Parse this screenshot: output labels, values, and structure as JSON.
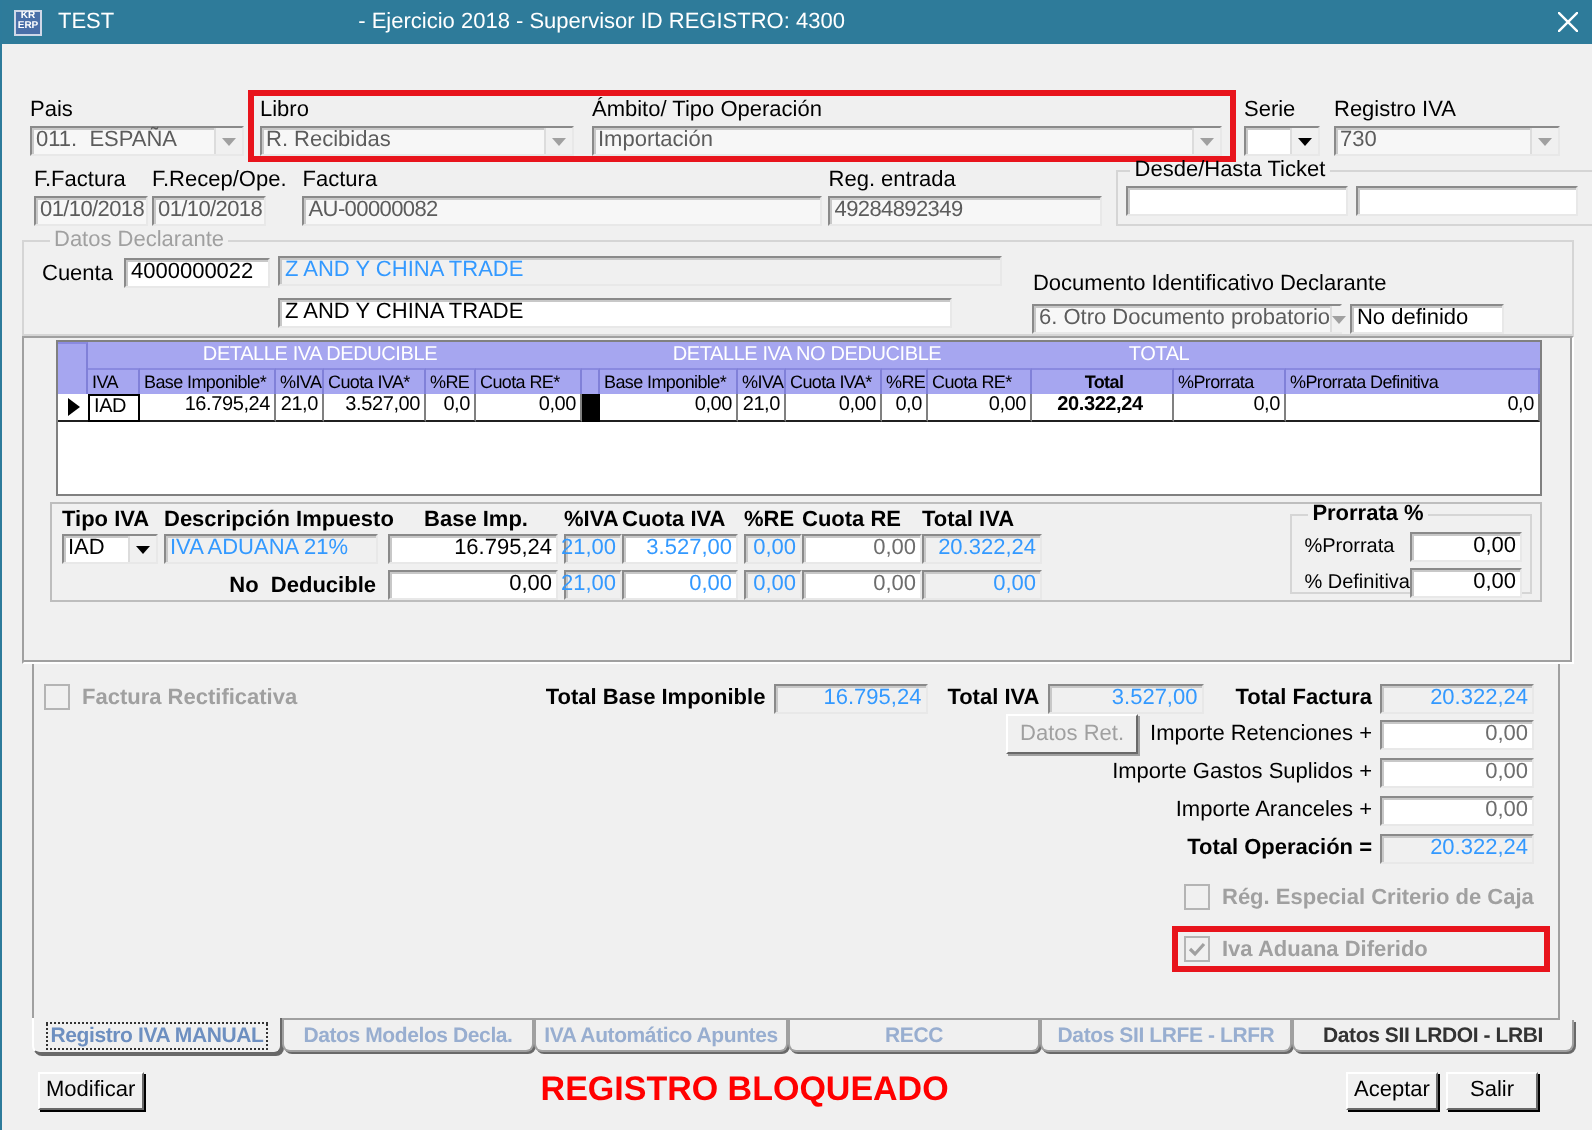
{
  "window": {
    "logo": [
      "KR",
      "ERP"
    ],
    "app": "TEST",
    "title": "- Ejercicio 2018 - Supervisor ID REGISTRO: 4300"
  },
  "header": {
    "row_1": [
      {
        "label": "Pais",
        "value": "011.  ESPAÑA",
        "kind": "disabled",
        "combo": true,
        "highlighted": false
      },
      {
        "label": "Libro",
        "value": "R. Recibidas",
        "kind": "disabled",
        "combo": true,
        "highlighted": true
      },
      {
        "label": "Ámbito/ Tipo Operación",
        "value": "Importación",
        "kind": "disabled",
        "combo": true,
        "highlighted": true
      },
      {
        "label": "Serie",
        "kind": "edit",
        "combo": true,
        "highlighted": false
      },
      {
        "label": "Registro IVA",
        "value": "730",
        "kind": "disabled",
        "combo": true,
        "highlighted": false
      }
    ],
    "row_2": [
      {
        "label": "F.Factura",
        "value": "01/10/2018",
        "kind": "disabled"
      },
      {
        "label": "F.Recep/Ope.",
        "value": "01/10/2018",
        "kind": "disabled"
      },
      {
        "label": "Factura",
        "value": "AU-00000082",
        "kind": "disabled"
      },
      {
        "label": "Reg. entrada",
        "value": "49284892349",
        "kind": "disabled"
      }
    ],
    "ticket": {
      "title": "Desde/Hasta Ticket",
      "fields": [
        {
          "kind": "edit"
        },
        {
          "kind": "edit"
        }
      ]
    }
  },
  "declarante": {
    "title": "Datos Declarante",
    "disabled": true,
    "account_label": "Cuenta",
    "account": {
      "value": "4000000022",
      "kind": "edit"
    },
    "name": {
      "value": "Z AND Y CHINA TRADE",
      "kind": "info"
    },
    "name_2": {
      "value": "Z AND Y CHINA TRADE",
      "kind": "edit"
    },
    "document_label": "Documento Identificativo Declarante",
    "document_type": {
      "value": "6. Otro Documento probatorio",
      "kind": "disabled",
      "combo": true
    },
    "document_number": {
      "value": "No definido",
      "kind": "edit"
    }
  },
  "vat_grid": {
    "groups": [
      "DETALLE IVA DEDUCIBLE",
      "DETALLE IVA NO DEDUCIBLE",
      "TOTAL"
    ],
    "columns": [
      "IVA",
      "Base Imponible*",
      "%IVA",
      "Cuota IVA*",
      "%RE",
      "Cuota RE*",
      "Base Imponible*",
      "%IVA",
      "Cuota IVA*",
      "%RE",
      "Cuota RE*",
      "Total",
      "%Prorrata",
      "%Prorrata Definitiva"
    ],
    "rows": [
      {
        "selected": true,
        "cells": [
          "IAD",
          "16.795,24",
          "21,0",
          "3.527,00",
          "0,0",
          "0,00",
          "0,00",
          "21,0",
          "0,00",
          "0,0",
          "0,00",
          "20.322,24",
          "0,0",
          "0,0"
        ]
      }
    ]
  },
  "tax_detail": {
    "headers": [
      "Tipo IVA",
      "Descripción Impuesto",
      "Base Imp.",
      "%IVA",
      "Cuota IVA",
      "%RE",
      "Cuota RE",
      "Total IVA"
    ],
    "rows": [
      {
        "cells": [
          {
            "value": "IAD",
            "kind": "edit",
            "combo": true
          },
          {
            "value": "IVA ADUANA 21%",
            "kind": "info"
          },
          {
            "value": "16.795,24",
            "kind": "edit"
          },
          {
            "value": "21,00",
            "kind": "info"
          },
          {
            "value": "3.527,00",
            "kind": "blue"
          },
          {
            "value": "0,00",
            "kind": "info"
          },
          {
            "value": "0,00",
            "kind": "dim"
          },
          {
            "value": "20.322,24",
            "kind": "info"
          }
        ]
      },
      {
        "cells": [
          {
            "kind": "blank"
          },
          {
            "value": "No  Deducible",
            "kind": "label"
          },
          {
            "value": "0,00",
            "kind": "edit"
          },
          {
            "value": "21,00",
            "kind": "info"
          },
          {
            "value": "0,00",
            "kind": "blue"
          },
          {
            "value": "0,00",
            "kind": "info"
          },
          {
            "value": "0,00",
            "kind": "dim"
          },
          {
            "value": "0,00",
            "kind": "info"
          }
        ]
      }
    ],
    "prorrata": {
      "title": "Prorrata %",
      "fields": [
        {
          "label": "%Prorrata",
          "value": "0,00",
          "kind": "edit"
        },
        {
          "label": "% Definitiva",
          "value": "0,00",
          "kind": "edit"
        }
      ]
    }
  },
  "rectificativa": {
    "label": "Factura Rectificativa",
    "checked": false,
    "disabled": true
  },
  "totals": [
    {
      "label": "Total Base Imponible",
      "value": "16.795,24",
      "kind": "info"
    },
    {
      "label": "Total IVA",
      "value": "3.527,00",
      "kind": "info"
    },
    {
      "label": "Total Factura",
      "value": "20.322,24",
      "kind": "info"
    }
  ],
  "retention_button": {
    "label": "Datos Ret.",
    "disabled": true
  },
  "adjustments": [
    {
      "label": "Importe Retenciones +",
      "value": "0,00",
      "kind": "input"
    },
    {
      "label": "Importe Gastos Suplidos +",
      "value": "0,00",
      "kind": "input"
    },
    {
      "label": "Importe Aranceles +",
      "value": "0,00",
      "kind": "input"
    },
    {
      "label": "Total Operación =",
      "value": "20.322,24",
      "kind": "total"
    }
  ],
  "options": [
    {
      "label": "Rég. Especial Criterio de Caja",
      "checked": false,
      "disabled": true,
      "highlighted": false
    },
    {
      "label": "Iva Aduana Diferido",
      "checked": true,
      "disabled": true,
      "highlighted": true
    }
  ],
  "tabs": [
    {
      "label": "Registro IVA MANUAL",
      "selected": true,
      "disabled": false
    },
    {
      "label": "Datos Modelos Decla.",
      "selected": false,
      "disabled": true
    },
    {
      "label": "IVA Automático Apuntes",
      "selected": false,
      "disabled": true
    },
    {
      "label": "RECC",
      "selected": false,
      "disabled": true
    },
    {
      "label": "Datos SII  LRFE - LRFR",
      "selected": false,
      "disabled": true
    },
    {
      "label": "Datos SII LRDOI - LRBI",
      "selected": false,
      "disabled": false
    }
  ],
  "footer": {
    "left_buttons": [
      "Modificar"
    ],
    "status": "REGISTRO BLOQUEADO",
    "right_buttons": [
      "Aceptar",
      "Salir"
    ]
  }
}
